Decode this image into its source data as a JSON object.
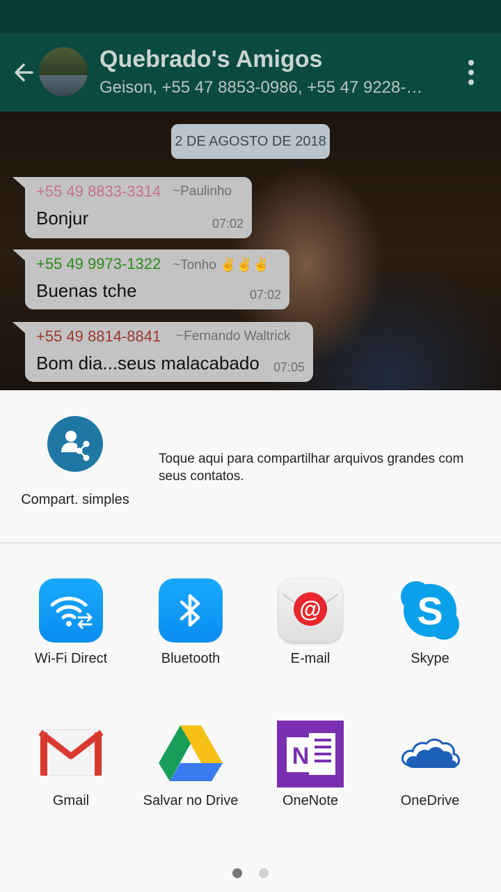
{
  "header": {
    "title": "Quebrado's Amigos",
    "subtitle": "Geison, +55 47 8853-0986, +55 47 9228-…"
  },
  "chat": {
    "date_chip": "2 DE AGOSTO DE 2018",
    "messages": [
      {
        "phone": "+55 49 8833-3314",
        "phone_color": "#c2708f",
        "nick": "~Paulinho",
        "text": "Bonjur",
        "time": "07:02"
      },
      {
        "phone": "+55 49 9973-1322",
        "phone_color": "#2c8a1c",
        "nick": "~Tonho ✌✌✌",
        "text": "Buenas tche",
        "time": "07:02"
      },
      {
        "phone": "+55 49 8814-8841",
        "phone_color": "#9a3a2c",
        "nick": "~Fernando Waltrick",
        "text": "Bom dia...seus malacabado",
        "time": "07:05"
      }
    ]
  },
  "share_sheet": {
    "simple_share": {
      "label": "Compart. simples",
      "description": "Toque aqui para compartilhar arquivos grandes com seus contatos."
    },
    "apps": [
      {
        "label": "Wi-Fi Direct",
        "icon": "wifi-direct-icon"
      },
      {
        "label": "Bluetooth",
        "icon": "bluetooth-icon"
      },
      {
        "label": "E-mail",
        "icon": "email-icon"
      },
      {
        "label": "Skype",
        "icon": "skype-icon"
      },
      {
        "label": "Gmail",
        "icon": "gmail-icon"
      },
      {
        "label": "Salvar no Drive",
        "icon": "google-drive-icon"
      },
      {
        "label": "OneNote",
        "icon": "onenote-icon"
      },
      {
        "label": "OneDrive",
        "icon": "onedrive-icon"
      }
    ],
    "pager": {
      "pages": 2,
      "current": 1
    }
  },
  "colors": {
    "appbar": "#0b4a41",
    "statusbar": "#0a3a33",
    "bubble": "#c3c3c3",
    "accent_blue": "#1f77a3"
  }
}
